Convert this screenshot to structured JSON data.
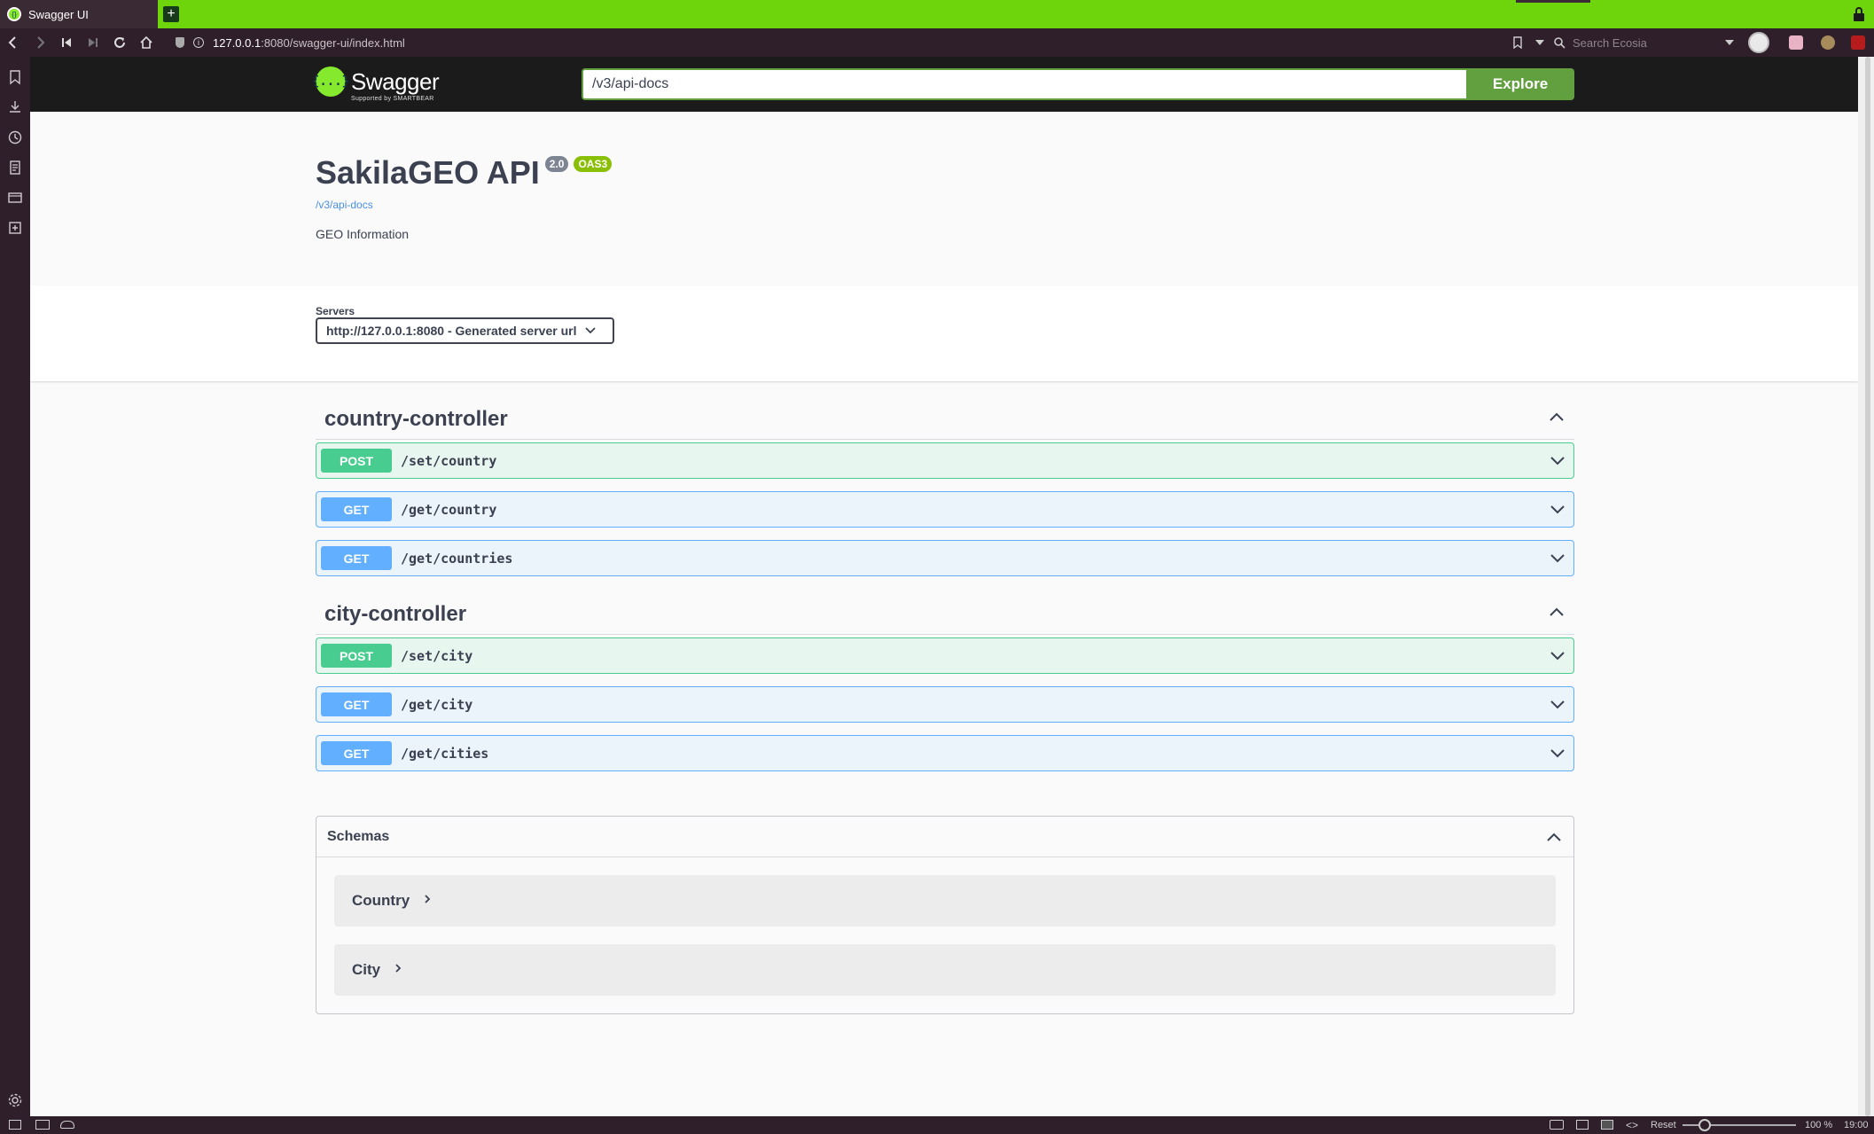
{
  "browser": {
    "tab_title": "Swagger UI",
    "new_tab": "+",
    "url_host": "127.0.0.1",
    "url_rest": ":8080/swagger-ui/index.html",
    "search_placeholder": "Search Ecosia",
    "status": {
      "reset": "Reset",
      "zoom": "100 %",
      "time": "19:00"
    }
  },
  "swagger": {
    "brand": "Swagger",
    "brand_sub": "Supported by SMARTBEAR",
    "api_url": "/v3/api-docs",
    "explore_label": "Explore",
    "title": "SakilaGEO API",
    "version": "2.0",
    "oas": "OAS3",
    "doc_link": "/v3/api-docs",
    "description": "GEO Information",
    "servers_label": "Servers",
    "server_selected": "http://127.0.0.1:8080 - Generated server url"
  },
  "tags": [
    {
      "name": "country-controller",
      "operations": [
        {
          "method": "POST",
          "path": "/set/country"
        },
        {
          "method": "GET",
          "path": "/get/country"
        },
        {
          "method": "GET",
          "path": "/get/countries"
        }
      ]
    },
    {
      "name": "city-controller",
      "operations": [
        {
          "method": "POST",
          "path": "/set/city"
        },
        {
          "method": "GET",
          "path": "/get/city"
        },
        {
          "method": "GET",
          "path": "/get/cities"
        }
      ]
    }
  ],
  "schemas": {
    "title": "Schemas",
    "models": [
      "Country",
      "City"
    ]
  },
  "colors": {
    "post": "#49cc90",
    "get": "#61affe",
    "explore": "#62a03f",
    "tabbar": "#6ed50c"
  }
}
